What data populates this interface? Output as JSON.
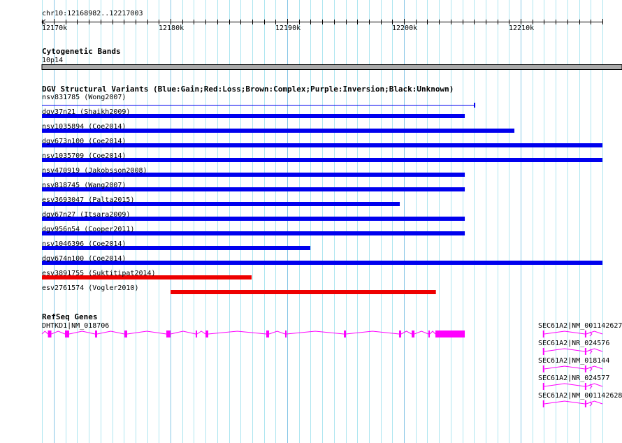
{
  "region": {
    "label": "chr10:12168982..12217003",
    "chrom": "chr10",
    "start": 12168982,
    "end": 12217003
  },
  "ruler": {
    "ticks_kb_step": 1,
    "major_labels": [
      "12170k",
      "12180k",
      "12190k",
      "12200k",
      "12210k"
    ],
    "major_positions": [
      12170000,
      12180000,
      12190000,
      12200000,
      12210000
    ]
  },
  "colors": {
    "grid_minor": "#aee6f0",
    "grid_major": "#86c6e6",
    "gain": "#0000ee",
    "loss": "#ee0000",
    "gene": "#ff00ff",
    "band": "#aaaaaa"
  },
  "cytoband": {
    "title": "Cytogenetic Bands",
    "band": "10p14"
  },
  "dgv": {
    "title": "DGV Structural Variants (Blue:Gain;Red:Loss;Brown:Complex;Purple:Inversion;Black:Unknown)",
    "variants": [
      {
        "label": "nsv831785 (Wong2007)",
        "start": 12168982,
        "end": 12206048,
        "type": "gain",
        "thin": true
      },
      {
        "label": "dgv37n21 (Shaikh2009)",
        "start": 12168982,
        "end": 12205210,
        "type": "gain"
      },
      {
        "label": "nsv1035894 (Coe2014)",
        "start": 12168982,
        "end": 12209460,
        "type": "gain"
      },
      {
        "label": "dgv673n100 (Coe2014)",
        "start": 12168982,
        "end": 12217003,
        "type": "gain"
      },
      {
        "label": "nsv1035709 (Coe2014)",
        "start": 12168982,
        "end": 12217003,
        "type": "gain"
      },
      {
        "label": "nsv470919 (Jakobsson2008)",
        "start": 12168982,
        "end": 12205210,
        "type": "gain"
      },
      {
        "label": "nsv818745 (Wang2007)",
        "start": 12168982,
        "end": 12205210,
        "type": "gain"
      },
      {
        "label": "esv3693047 (Palta2015)",
        "start": 12168982,
        "end": 12199640,
        "type": "gain"
      },
      {
        "label": "dgv67n27 (Itsara2009)",
        "start": 12168982,
        "end": 12205210,
        "type": "gain"
      },
      {
        "label": "dgv956n54 (Cooper2011)",
        "start": 12168982,
        "end": 12205210,
        "type": "gain"
      },
      {
        "label": "nsv1046396 (Coe2014)",
        "start": 12168982,
        "end": 12191975,
        "type": "gain"
      },
      {
        "label": "dgv674n100 (Coe2014)",
        "start": 12168982,
        "end": 12217003,
        "type": "gain"
      },
      {
        "label": "esv3891755 (Suktitipat2014)",
        "start": 12168982,
        "end": 12186946,
        "type": "loss"
      },
      {
        "label": "esv2761574 (Vogler2010)",
        "start": 12180000,
        "end": 12202735,
        "type": "loss"
      }
    ]
  },
  "refseq": {
    "title": "RefSeq Genes",
    "genes": [
      {
        "label": "DHTKD1|NM_018706",
        "start": 12168982,
        "end": 12205209,
        "exons": [
          [
            12169497,
            12169790
          ],
          [
            12170958,
            12171317
          ],
          [
            12173533,
            12173713
          ],
          [
            12176048,
            12176287
          ],
          [
            12179641,
            12180000
          ],
          [
            12182156,
            12182275
          ],
          [
            12182994,
            12183233
          ],
          [
            12188203,
            12188443
          ],
          [
            12189820,
            12189940
          ],
          [
            12194850,
            12195030
          ],
          [
            12199580,
            12199760
          ],
          [
            12200658,
            12200898
          ],
          [
            12202095,
            12202215
          ],
          [
            12202694,
            12205209
          ]
        ]
      },
      {
        "label": "SEC61A2|NM_001142627",
        "start": 12211900,
        "end": 12217003,
        "exons": [
          [
            12211900,
            12212020
          ],
          [
            12215500,
            12215600
          ]
        ]
      },
      {
        "label": "SEC61A2|NR_024576",
        "start": 12211900,
        "end": 12217003,
        "exons": [
          [
            12211900,
            12212020
          ],
          [
            12215500,
            12215600
          ]
        ]
      },
      {
        "label": "SEC61A2|NM_018144",
        "start": 12211900,
        "end": 12217003,
        "exons": [
          [
            12211900,
            12212020
          ],
          [
            12215500,
            12215600
          ]
        ]
      },
      {
        "label": "SEC61A2|NR_024577",
        "start": 12211900,
        "end": 12217003,
        "exons": [
          [
            12211900,
            12212020
          ],
          [
            12215500,
            12215600
          ]
        ]
      },
      {
        "label": "SEC61A2|NM_001142628",
        "start": 12211900,
        "end": 12217003,
        "exons": [
          [
            12211900,
            12212020
          ],
          [
            12215500,
            12215600
          ]
        ]
      }
    ]
  }
}
